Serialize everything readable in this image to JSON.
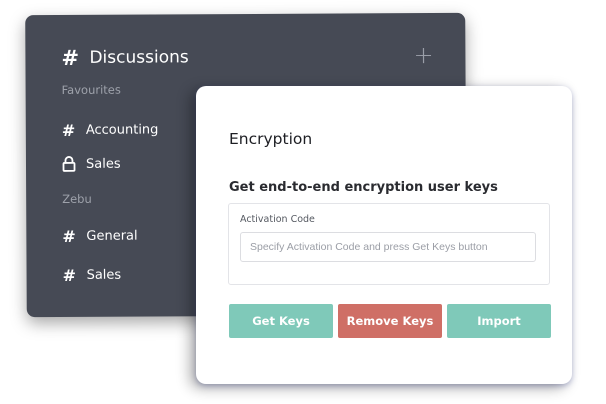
{
  "sidebar": {
    "header": {
      "icon": "#",
      "title": "Discussions"
    },
    "add_icon": "+",
    "sections": [
      {
        "label": "Favourites",
        "items": [
          {
            "icon": "hash-icon",
            "label": "Accounting"
          },
          {
            "icon": "lock-icon",
            "label": "Sales"
          }
        ]
      },
      {
        "label": "Zebu",
        "items": [
          {
            "icon": "hash-icon",
            "label": "General"
          },
          {
            "icon": "hash-icon",
            "label": "Sales"
          }
        ]
      }
    ],
    "hash_glyph": "#"
  },
  "card": {
    "title": "Encryption",
    "subtitle": "Get end-to-end encryption user keys",
    "activation": {
      "label": "Activation Code",
      "placeholder": "Specify Activation Code and press Get Keys button"
    },
    "buttons": {
      "get_keys": "Get Keys",
      "remove_keys": "Remove Keys",
      "import": "Import"
    }
  },
  "colors": {
    "sidebar_bg": "#464a55",
    "accent_teal": "#7fc9b9",
    "danger_red": "#cf6f66"
  }
}
